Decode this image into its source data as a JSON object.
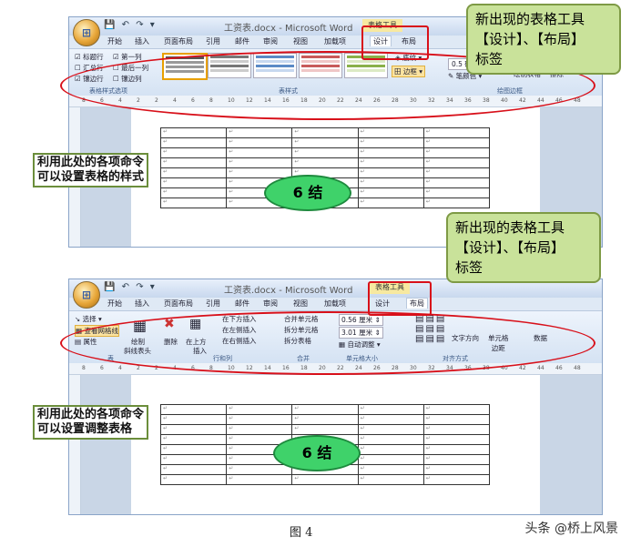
{
  "top_screenshot": {
    "window_title": "工资表.docx - Microsoft Word",
    "context_tab_title": "表格工具",
    "tabs": [
      "开始",
      "插入",
      "页面布局",
      "引用",
      "邮件",
      "审阅",
      "视图",
      "加载项",
      "设计",
      "布局"
    ],
    "active_tab": "设计",
    "style_options": [
      "标题行",
      "第一列",
      "汇总行",
      "最后一列",
      "镶边行",
      "镶边列"
    ],
    "shading_label": "底纹",
    "borders_label": "边框",
    "pen_weight": "0.5 磅",
    "pen_color_label": "笔颜色",
    "draw_table_label": "绘制表格",
    "eraser_label": "擦除",
    "group_labels": [
      "表格样式选项",
      "表样式",
      "绘图边框"
    ],
    "ruler_ticks": [
      "8",
      "6",
      "4",
      "2",
      "2",
      "4",
      "6",
      "8",
      "10",
      "12",
      "14",
      "16",
      "18",
      "20",
      "22",
      "24",
      "26",
      "28",
      "30",
      "32",
      "34",
      "36",
      "38",
      "40",
      "42",
      "44",
      "46",
      "48"
    ]
  },
  "bottom_screenshot": {
    "window_title": "工资表.docx - Microsoft Word",
    "context_tab_title": "表格工具",
    "tabs": [
      "开始",
      "插入",
      "页面布局",
      "引用",
      "邮件",
      "审阅",
      "视图",
      "加载项",
      "设计",
      "布局"
    ],
    "active_tab": "布局",
    "select_label": "选择",
    "view_gridlines_label": "查看网格线",
    "properties_label": "属性",
    "draw_label": "绘制",
    "diag_label": "斜线表头",
    "delete_label": "删除",
    "insert_above_label": "在上方",
    "insert_label": "插入",
    "insert_below": "在下方插入",
    "insert_left": "在左侧插入",
    "insert_right": "在右侧插入",
    "merge_cells": "合并单元格",
    "split_cells": "拆分单元格",
    "split_table": "拆分表格",
    "height_value": "0.56 厘米",
    "width_value": "3.01 厘米",
    "autofit_label": "自动调整",
    "text_direction": "文字方向",
    "cell_margins_1": "单元格",
    "cell_margins_2": "边距",
    "data_label": "数据",
    "group_labels": [
      "表",
      "行和列",
      "合并",
      "单元格大小",
      "对齐方式"
    ]
  },
  "annotations": {
    "callout_top": [
      "新出现的表格工具",
      "【设计】、【布局】",
      "标签"
    ],
    "callout_bottom": [
      "新出现的表格工具",
      "【设计】、【布局】",
      "标签"
    ],
    "note_top": [
      "利用此处的各项命令",
      "可以设置表格的样式"
    ],
    "note_bottom": [
      "利用此处的各项命令",
      "可以设置调整表格"
    ],
    "stamp_text": "6 结"
  },
  "caption": "图 4",
  "watermark": "头条 @桥上风景",
  "colors": {
    "callout_bg": "#c9e29a",
    "highlight_red": "#d8101a",
    "stamp_green": "#3fd26a"
  }
}
